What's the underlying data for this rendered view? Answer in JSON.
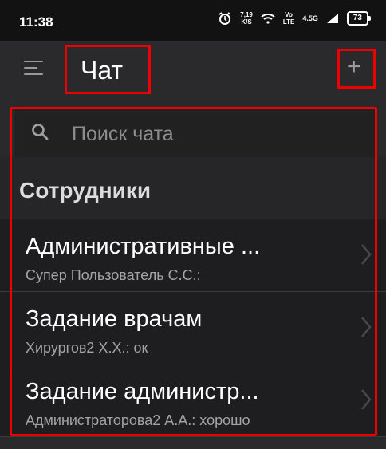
{
  "status_bar": {
    "time": "11:38",
    "speed_value": "7,19",
    "speed_unit": "K/S",
    "vo_top": "Vo",
    "vo_bottom": "LTE",
    "network": "4.5G",
    "battery": "73",
    "icons": [
      "alarm-icon",
      "wifi-icon",
      "signal-icon",
      "battery-icon"
    ]
  },
  "app_bar": {
    "title": "Чат",
    "add_label": "+",
    "icons": [
      "menu-icon"
    ]
  },
  "search": {
    "placeholder": "Поиск чата",
    "value": "",
    "icon": "search-icon"
  },
  "section": {
    "title": "Сотрудники"
  },
  "chats": [
    {
      "title": "Административные ...",
      "preview": "Супер Пользователь С.С.:"
    },
    {
      "title": "Задание врачам",
      "preview": "Хирургов2 Х.Х.: ок"
    },
    {
      "title": "Задание администр...",
      "preview": "Администраторова2 А.А.: хорошо"
    }
  ],
  "colors": {
    "highlight": "#ee0000",
    "background": "#1c1c1e",
    "text_secondary": "#a4a4a4"
  }
}
